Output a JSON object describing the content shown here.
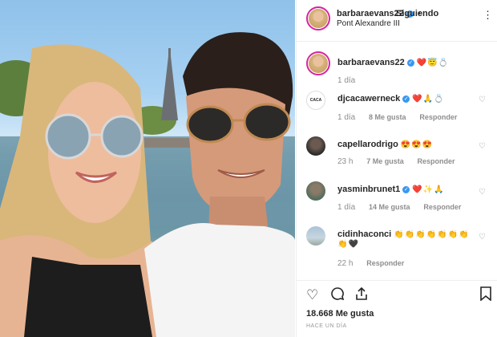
{
  "post": {
    "author": "barbaraevans22",
    "follow_status": "Siguiendo",
    "separator": "•",
    "location": "Pont Alexandre III",
    "close_label": "⋮"
  },
  "caption": {
    "username": "barbaraevans22",
    "text": "❤️😇💍",
    "time": "1 día"
  },
  "comments": [
    {
      "username": "djcacawerneck",
      "text": "❤️🙏💍",
      "time": "1 día",
      "likes": "8 Me gusta",
      "reply": "Responder"
    },
    {
      "username": "capellarodrigo",
      "text": "😍😍😍",
      "time": "23 h",
      "likes": "7 Me gusta",
      "reply": "Responder"
    },
    {
      "username": "yasminbrunet1",
      "text": "❤️✨🙏",
      "time": "1 día",
      "likes": "14 Me gusta",
      "reply": "Responder"
    },
    {
      "username": "cidinhaconci",
      "text": "👏👏👏👏👏👏👏",
      "text2": "👏🖤",
      "time": "22 h",
      "reply": "Responder"
    }
  ],
  "actions": {
    "like_icon": "heart-icon",
    "comment_icon": "comment-icon",
    "share_icon": "share-icon",
    "save_icon": "bookmark-icon"
  },
  "likes_count": "18.668 Me gusta",
  "posted_ago": "HACE UN DÍA",
  "colors": {
    "verified": "#3897f0",
    "story_ring": "#d6249f",
    "muted_text": "#8e8e8e"
  }
}
